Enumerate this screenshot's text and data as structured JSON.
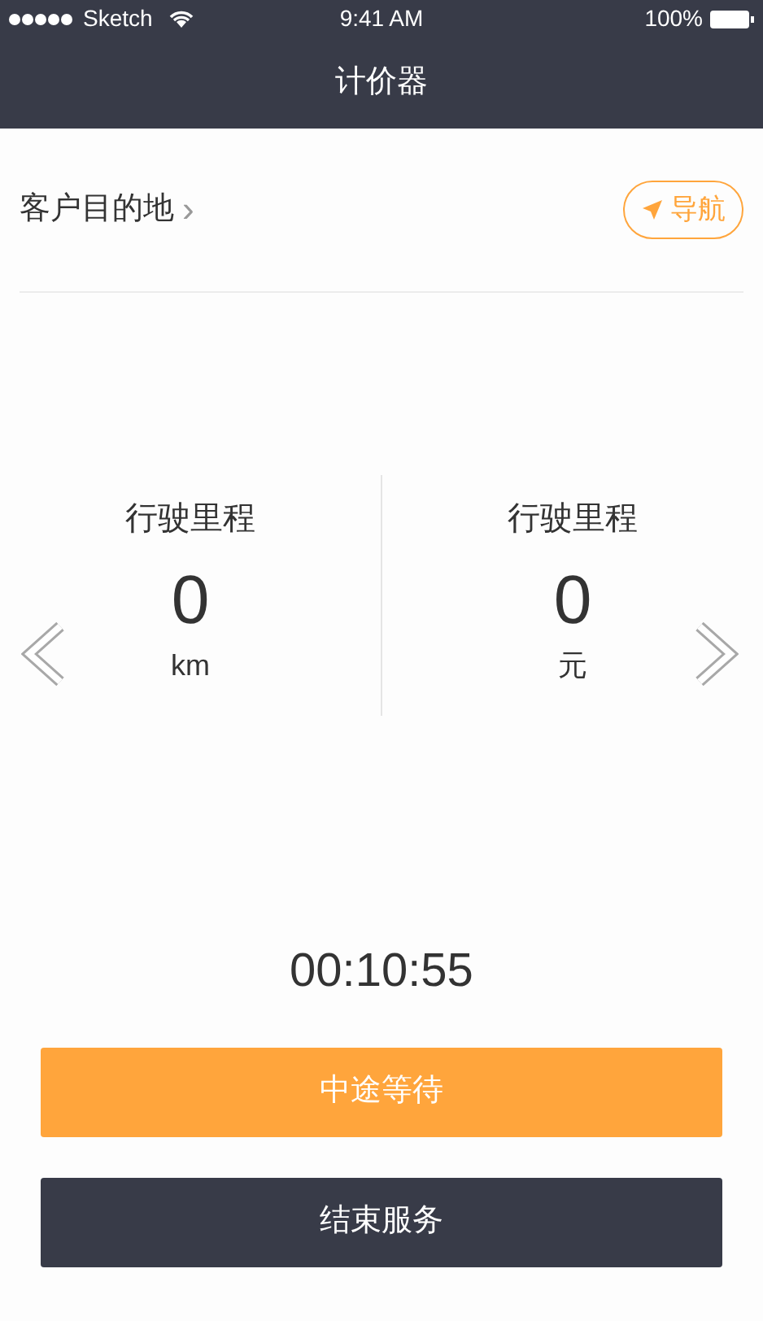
{
  "status_bar": {
    "carrier": "Sketch",
    "time": "9:41 AM",
    "battery": "100%"
  },
  "nav_bar": {
    "title": "计价器"
  },
  "destination": {
    "label": "客户目的地",
    "chevron": "›",
    "navigate_button": "导航"
  },
  "metrics": [
    {
      "title": "行驶里程",
      "value": "0",
      "unit": "km"
    },
    {
      "title": "行驶里程",
      "value": "0",
      "unit": "元"
    }
  ],
  "timer": "00:10:55",
  "buttons": [
    {
      "label": "中途等待",
      "kind": "primary"
    },
    {
      "label": "结束服务",
      "kind": "dark"
    }
  ]
}
